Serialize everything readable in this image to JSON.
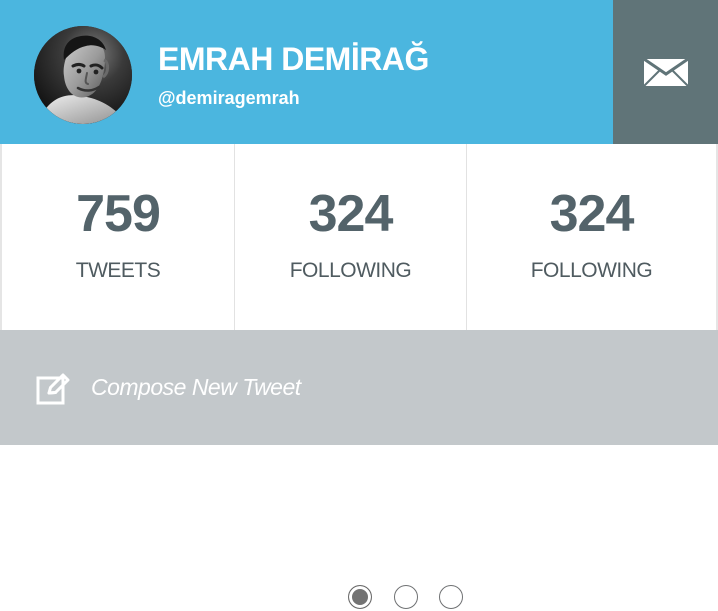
{
  "profile": {
    "name": "EMRAH DEMİRAĞ",
    "handle": "@demiragemrah",
    "avatar_icon": "profile-photo",
    "message_icon": "mail-icon"
  },
  "stats": [
    {
      "value": "759",
      "label": "TWEETS"
    },
    {
      "value": "324",
      "label": "FOLLOWING"
    },
    {
      "value": "324",
      "label": "FOLLOWING"
    }
  ],
  "compose": {
    "label": "Compose New Tweet",
    "icon": "edit-icon"
  },
  "pagination": {
    "pages": 3,
    "current_page": 1
  },
  "colors": {
    "header": "#4bb6df",
    "message_button": "#607478",
    "stat_text": "#53636a",
    "compose_background": "#c3c8cb",
    "white": "#ffffff"
  }
}
